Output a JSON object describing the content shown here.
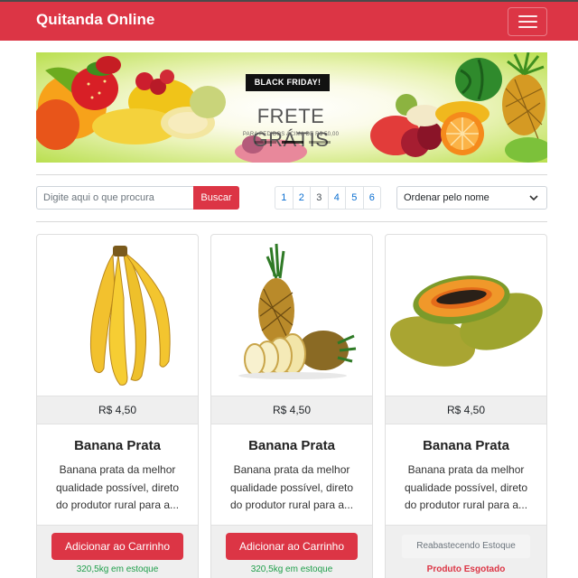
{
  "navbar": {
    "brand": "Quitanda Online",
    "menu_icon": "hamburger-icon"
  },
  "banner": {
    "tag": "BLACK FRIDAY!",
    "headline": "FRETE GRÁTIS",
    "subline": "PARA PEDIDOS ACIMA DE R$ 50,00",
    "slides": 3,
    "active_slide": 2
  },
  "search": {
    "placeholder": "Digite aqui o que procura",
    "value": "",
    "button_label": "Buscar"
  },
  "pagination": {
    "pages": [
      "1",
      "2",
      "3",
      "4",
      "5",
      "6"
    ],
    "current": "3"
  },
  "sort": {
    "selected": "Ordenar pelo nome",
    "icon": "chevron-down-icon"
  },
  "colors": {
    "primary": "#dc3545",
    "stock_ok": "#1e9e4a",
    "link": "#0b6fd1"
  },
  "products": [
    {
      "image": "banana-image",
      "price": "R$ 4,50",
      "name": "Banana Prata",
      "description": "Banana prata da melhor qualidade possível, direto do produtor rural para a...",
      "action_label": "Adicionar ao Carrinho",
      "available": true,
      "stock_text": "320,5kg em estoque"
    },
    {
      "image": "pineapple-image",
      "price": "R$ 4,50",
      "name": "Banana Prata",
      "description": "Banana prata da melhor qualidade possível, direto do produtor rural para a...",
      "action_label": "Adicionar ao Carrinho",
      "available": true,
      "stock_text": "320,5kg em estoque"
    },
    {
      "image": "papaya-image",
      "price": "R$ 4,50",
      "name": "Banana Prata",
      "description": "Banana prata da melhor qualidade possível, direto do produtor rural para a...",
      "action_label": "Reabastecendo Estoque",
      "available": false,
      "stock_text": "Produto Esgotado"
    }
  ]
}
